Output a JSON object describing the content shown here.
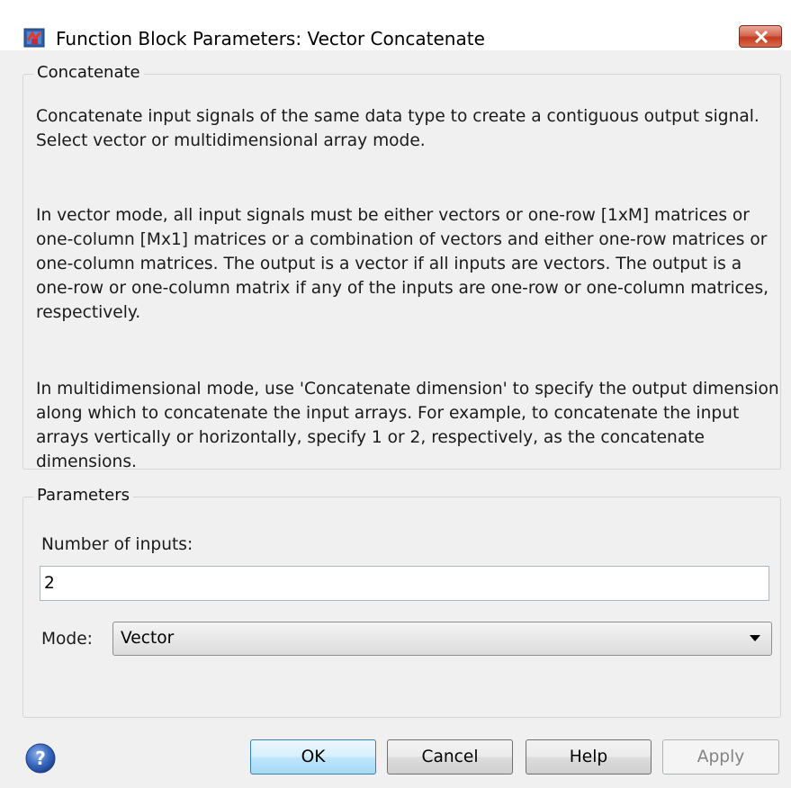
{
  "window": {
    "title": "Function Block Parameters: Vector Concatenate"
  },
  "description_group": {
    "title": "Concatenate",
    "paragraphs": [
      "Concatenate input signals of the same data type to create a contiguous output signal. Select vector or multidimensional array mode.",
      "In vector mode, all input signals must be either vectors or one-row [1xM] matrices or one-column [Mx1] matrices or a combination of vectors and either one-row matrices or one-column matrices. The output is a vector if all inputs are vectors. The output is a one-row or one-column matrix if any of the inputs are one-row or one-column matrices, respectively.",
      "In multidimensional mode, use 'Concatenate dimension' to specify the output dimension along which to concatenate the input arrays. For example, to concatenate the input arrays vertically or horizontally, specify 1 or 2, respectively, as the concatenate dimensions."
    ]
  },
  "parameters_group": {
    "title": "Parameters",
    "num_inputs_label": "Number of inputs:",
    "num_inputs_value": "2",
    "mode_label": "Mode:",
    "mode_value": "Vector"
  },
  "buttons": {
    "ok": "OK",
    "cancel": "Cancel",
    "help": "Help",
    "apply": "Apply"
  },
  "icons": {
    "app": "simulink-block-icon",
    "close": "close-icon",
    "help": "help-icon",
    "dropdown": "chevron-down-icon"
  }
}
